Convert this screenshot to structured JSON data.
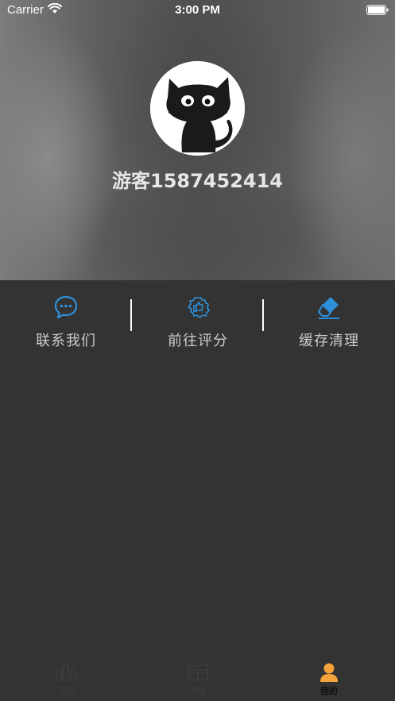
{
  "status_bar": {
    "carrier": "Carrier",
    "time": "3:00 PM"
  },
  "profile": {
    "username": "游客1587452414",
    "avatar_icon": "black-cat-avatar"
  },
  "actions": [
    {
      "label": "联系我们",
      "icon": "chat-bubble-icon"
    },
    {
      "label": "前往评分",
      "icon": "thumbs-up-icon"
    },
    {
      "label": "缓存清理",
      "icon": "eraser-icon"
    }
  ],
  "tabs": [
    {
      "label": "书架",
      "icon": "bookshelf-icon",
      "active": false
    },
    {
      "label": "书城",
      "icon": "open-book-icon",
      "active": false
    },
    {
      "label": "我的",
      "icon": "person-icon",
      "active": true
    }
  ],
  "colors": {
    "accent_blue": "#2f8fd8",
    "active_orange": "#f5a23a",
    "background": "#333333"
  }
}
